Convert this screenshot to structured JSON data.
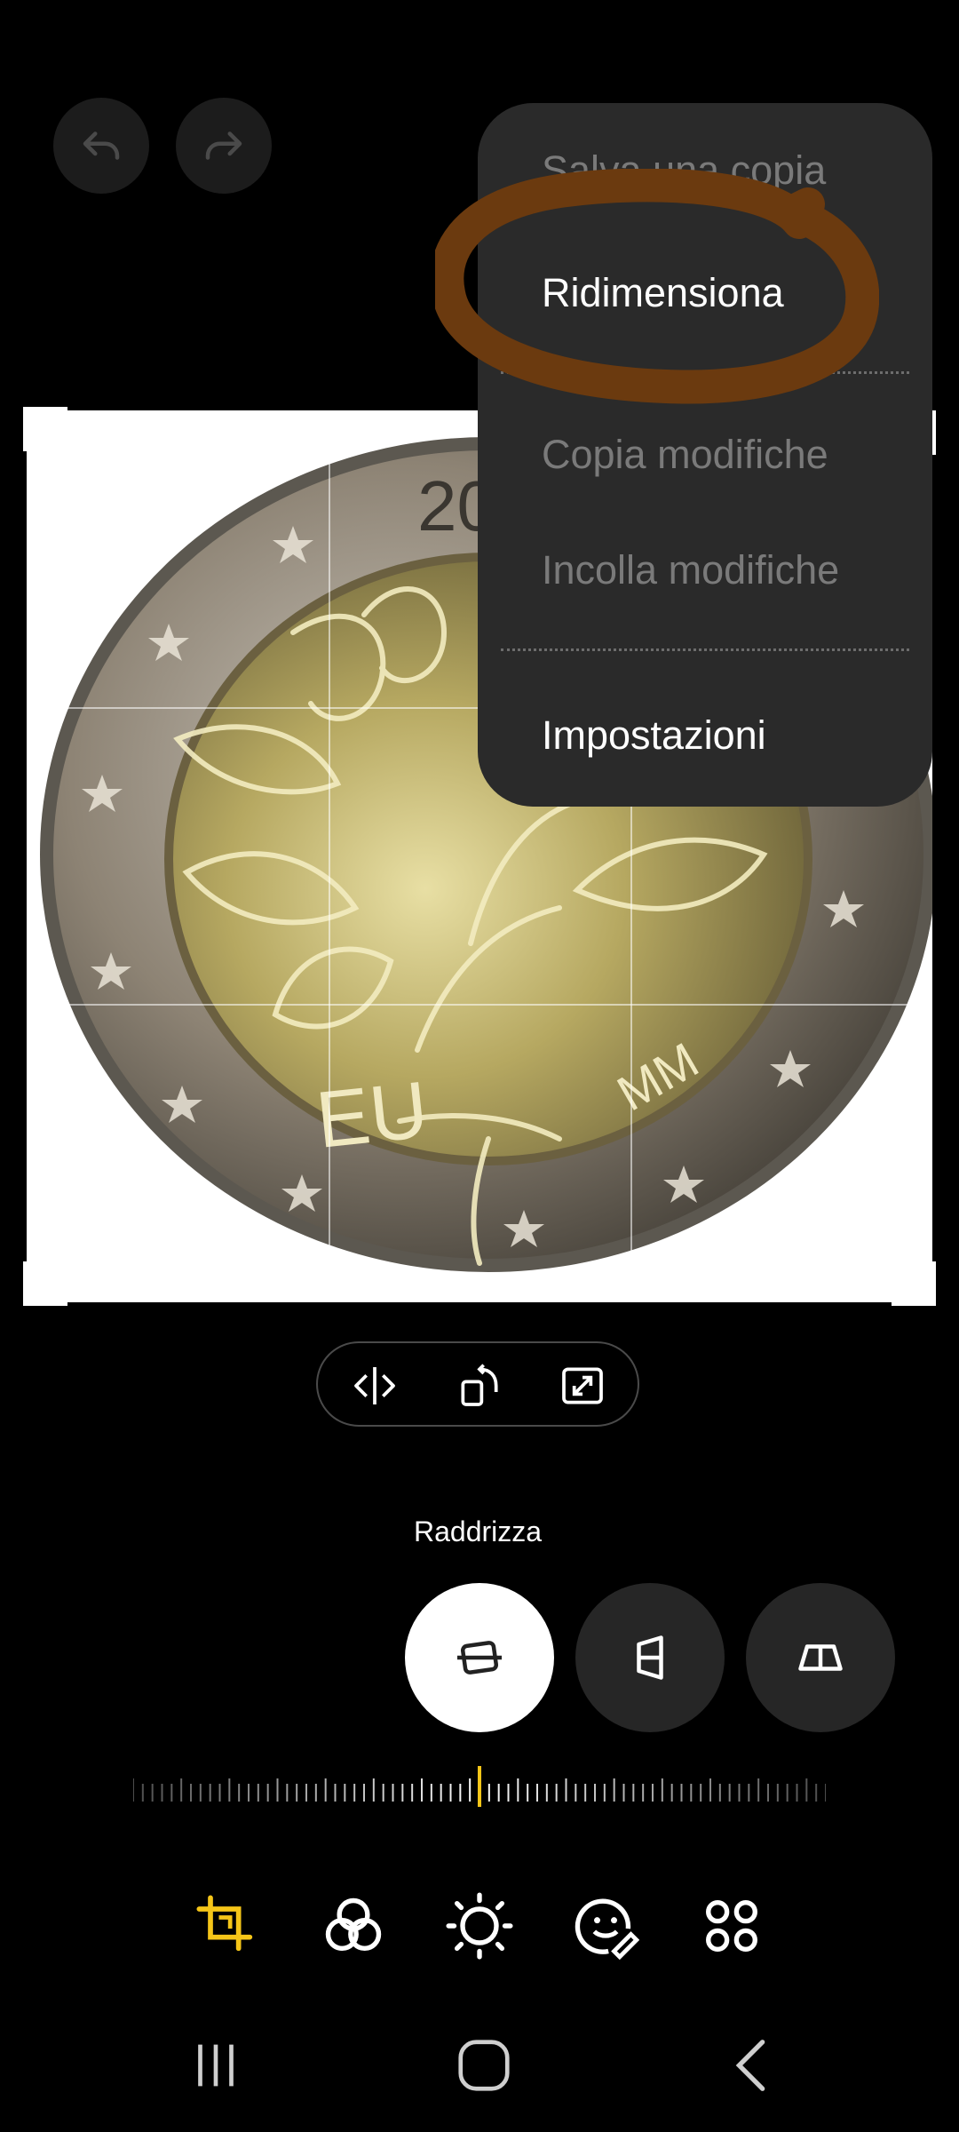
{
  "toolbar": {
    "undo_icon": "undo-arrow-icon",
    "redo_icon": "redo-arrow-icon"
  },
  "menu": {
    "items": [
      {
        "label": "Salva una copia",
        "enabled": false
      },
      {
        "label": "Ridimensiona",
        "enabled": true,
        "highlighted": true
      },
      {
        "label": "Copia modifiche",
        "enabled": false
      },
      {
        "label": "Incolla modifiche",
        "enabled": false
      },
      {
        "label": "Impostazioni",
        "enabled": true
      }
    ],
    "highlight_color": "#6b3a0f"
  },
  "image": {
    "coin_text_top": "20",
    "coin_text_eu": "EU",
    "coin_text_mm": "MM"
  },
  "tools": {
    "flip_icon": "flip-horizontal-icon",
    "rotate_icon": "rotate-icon",
    "expand_icon": "aspect-ratio-icon"
  },
  "straighten": {
    "label": "Raddrizza",
    "modes": [
      "straighten-icon",
      "vertical-perspective-icon",
      "horizontal-perspective-icon"
    ],
    "selected": 0,
    "dial_value": 0
  },
  "bottom_nav": {
    "items": [
      "crop-rotate-icon",
      "filters-icon",
      "brightness-icon",
      "sticker-icon",
      "more-tools-icon"
    ],
    "active_index": 0,
    "accent": "#f5c518"
  },
  "system_nav": [
    "recent-apps-icon",
    "home-icon",
    "back-icon"
  ]
}
